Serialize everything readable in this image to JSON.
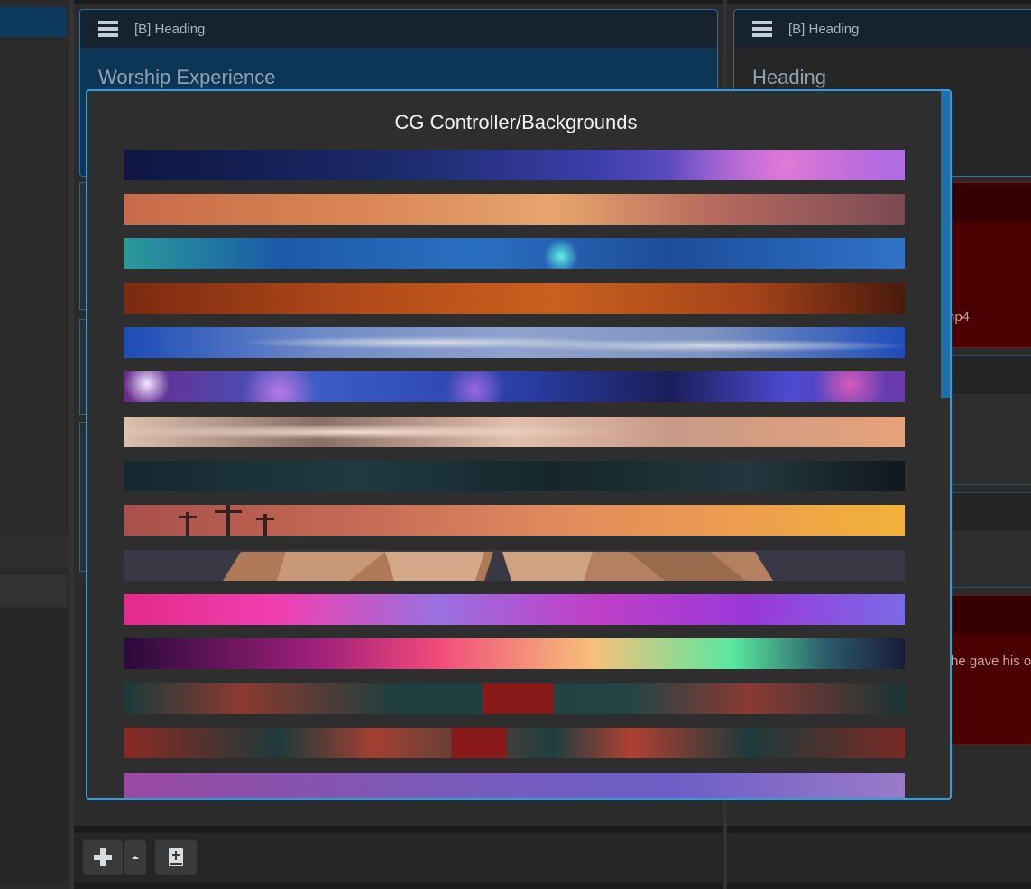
{
  "center_card": {
    "head_label": "[B]  Heading",
    "title": "Worship Experience"
  },
  "right_card": {
    "head_label": "[B]  Heading",
    "title": "Heading",
    "red_snippet_1": "np4",
    "red_snippet_2": "he gave his o"
  },
  "modal": {
    "title": "CG Controller/Backgrounds",
    "backgrounds": [
      {
        "name": "space-nebula"
      },
      {
        "name": "sunset-gradient"
      },
      {
        "name": "blue-aqua-light"
      },
      {
        "name": "orange-bokeh"
      },
      {
        "name": "blue-smoke"
      },
      {
        "name": "purple-bubbles"
      },
      {
        "name": "sky-clouds"
      },
      {
        "name": "starfield"
      },
      {
        "name": "three-crosses-sunset"
      },
      {
        "name": "low-poly-hands"
      },
      {
        "name": "pink-purple-gradient"
      },
      {
        "name": "aurora"
      },
      {
        "name": "red-teal-grunge-1"
      },
      {
        "name": "red-teal-grunge-2"
      },
      {
        "name": "lavender-gradient"
      }
    ]
  },
  "toolbar": {
    "add_icon": "plus-icon",
    "caret_icon": "caret-up-icon",
    "bible_icon": "bible-icon"
  },
  "colors": {
    "accent_border": "#2aa0e0",
    "card_body": "#0c3556",
    "red_card": "#4a0000"
  }
}
